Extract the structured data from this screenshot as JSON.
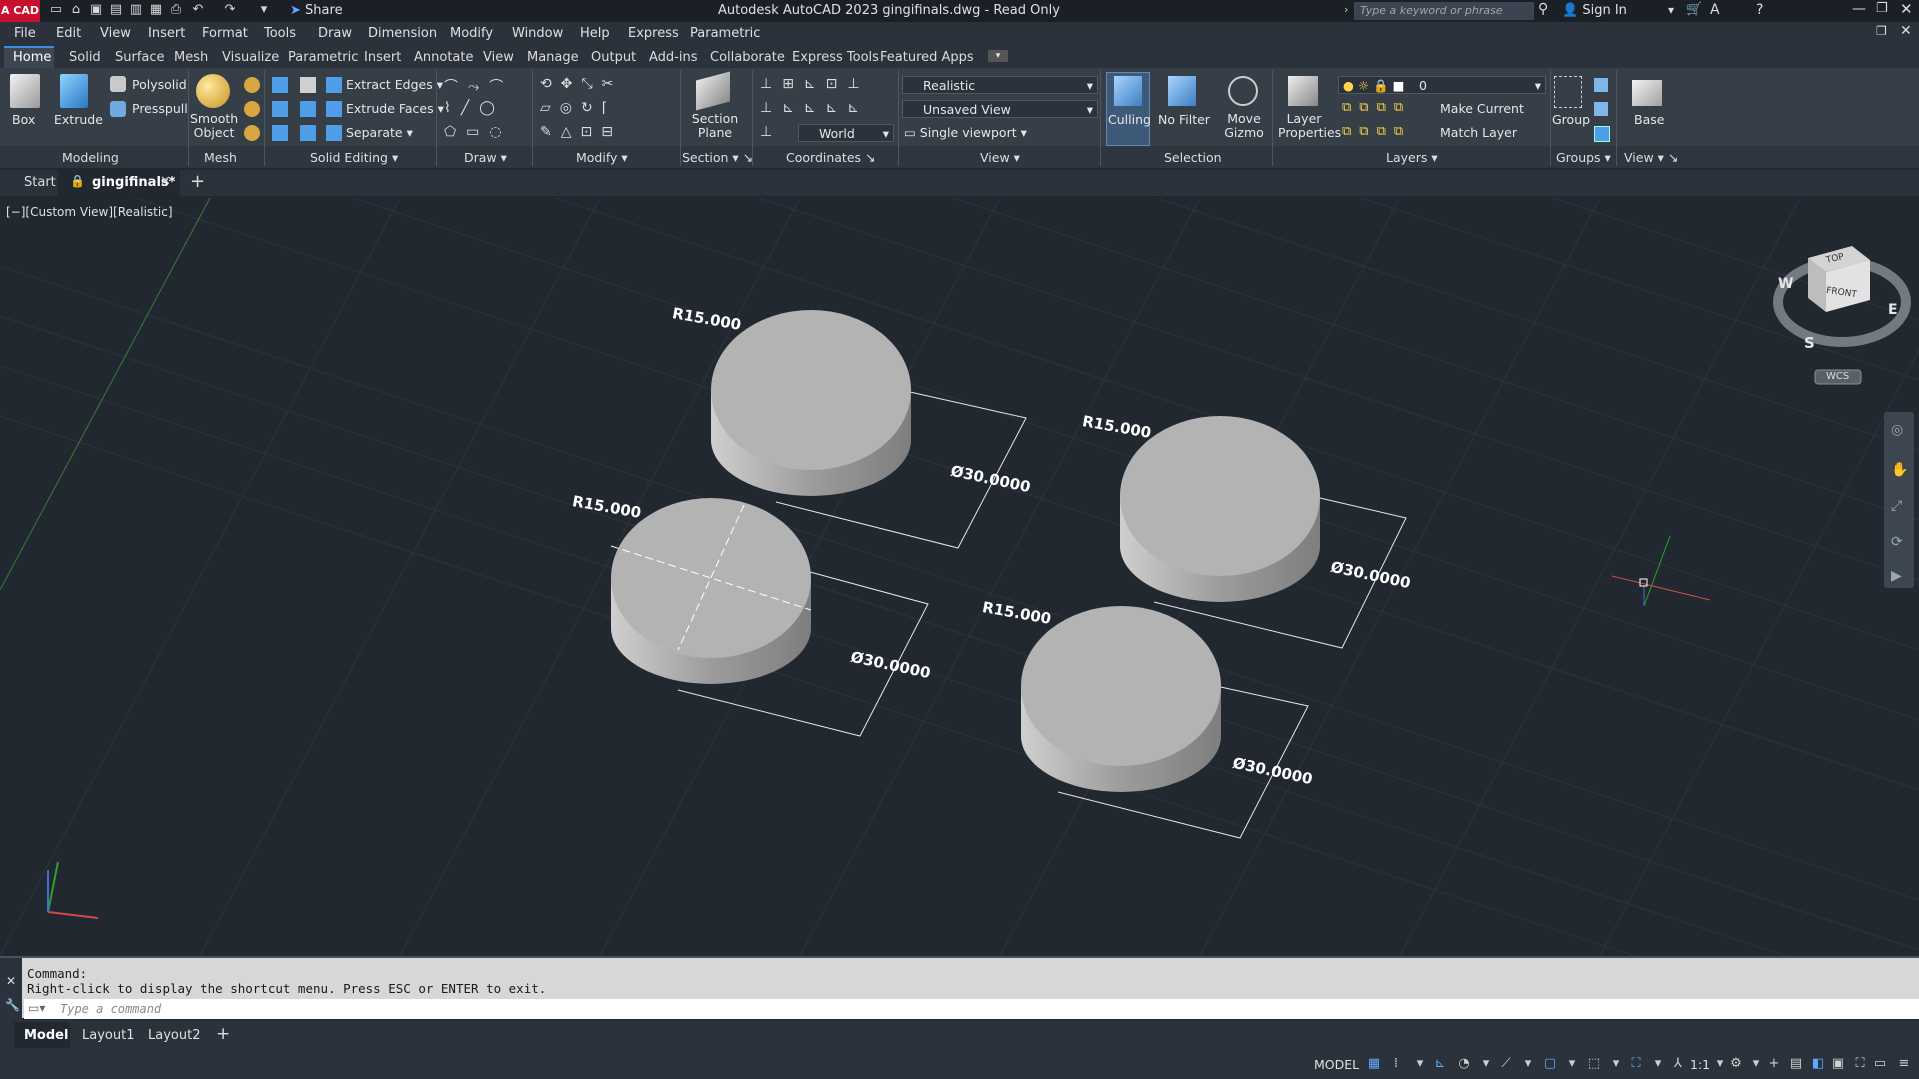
{
  "app": {
    "logo_text": "A CAD",
    "title": "Autodesk AutoCAD 2023    gingifinals.dwg - Read Only",
    "share_label": "Share",
    "search_placeholder": "Type a keyword or phrase",
    "sign_in": "Sign In"
  },
  "menubar": [
    "File",
    "Edit",
    "View",
    "Insert",
    "Format",
    "Tools",
    "Draw",
    "Dimension",
    "Modify",
    "Window",
    "Help",
    "Express",
    "Parametric"
  ],
  "ribbon_tabs": [
    "Home",
    "Solid",
    "Surface",
    "Mesh",
    "Visualize",
    "Parametric",
    "Insert",
    "Annotate",
    "View",
    "Manage",
    "Output",
    "Add-ins",
    "Collaborate",
    "Express Tools",
    "Featured Apps"
  ],
  "ribbon": {
    "modeling": {
      "box": "Box",
      "extrude": "Extrude",
      "polysolid": "Polysolid",
      "presspull": "Presspull",
      "label": "Modeling"
    },
    "mesh": {
      "smooth_object": "Smooth Object",
      "label": "Mesh"
    },
    "solid_editing": {
      "extract_edges": "Extract Edges",
      "extrude_faces": "Extrude Faces",
      "separate": "Separate",
      "label": "Solid Editing"
    },
    "draw": {
      "label": "Draw"
    },
    "modify": {
      "label": "Modify"
    },
    "section": {
      "section_plane": "Section Plane",
      "label": "Section"
    },
    "coordinates": {
      "world": "World",
      "label": "Coordinates"
    },
    "view": {
      "visual_style": "Realistic",
      "saved_view": "Unsaved View",
      "viewport": "Single viewport",
      "label": "View"
    },
    "selection": {
      "culling": "Culling",
      "no_filter": "No Filter",
      "move_gizmo": "Move Gizmo",
      "label": "Selection"
    },
    "layers": {
      "layer_properties": "Layer Properties",
      "layer_value": "0",
      "make_current": "Make Current",
      "match_layer": "Match Layer",
      "label": "Layers"
    },
    "groups": {
      "group": "Group",
      "label": "Groups"
    },
    "view2": {
      "base": "Base",
      "label": "View"
    }
  },
  "file_tabs": {
    "start": "Start",
    "doc": "gingifinals*"
  },
  "viewport": {
    "label": "[−][Custom View][Realistic]",
    "viewcube": {
      "top": "TOP",
      "front": "FRONT",
      "w": "W",
      "e": "E",
      "s": "S",
      "wcs": "WCS"
    },
    "dims": [
      {
        "radius": "R15.000",
        "diameter": "Ø30.0000"
      },
      {
        "radius": "R15.000",
        "diameter": "Ø30.0000"
      },
      {
        "radius": "R15.000",
        "diameter": "Ø30.0000"
      },
      {
        "radius": "R15.000",
        "diameter": "Ø30.0000"
      }
    ]
  },
  "command": {
    "line1": "Command:",
    "line2": "Right-click to display the shortcut menu. Press ESC or ENTER to exit.",
    "placeholder": "Type a command"
  },
  "layout_tabs": [
    "Model",
    "Layout1",
    "Layout2"
  ],
  "status": {
    "model": "MODEL",
    "scale": "1:1"
  },
  "colors": {
    "accent": "#3a8ee6",
    "cylinder": "#b3b3b3",
    "viewport_bg": "#212830"
  }
}
